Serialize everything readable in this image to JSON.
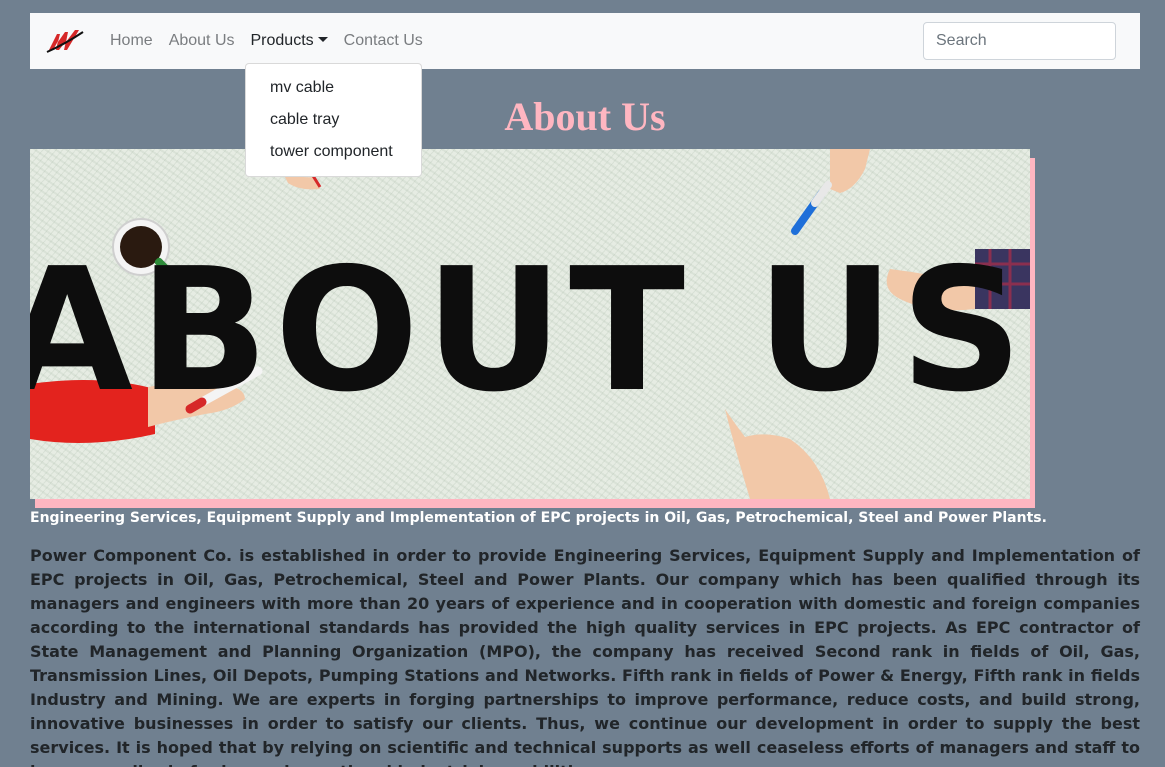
{
  "nav": {
    "logo_icon": "power-component-logo",
    "items": [
      {
        "label": "Home"
      },
      {
        "label": "About Us"
      },
      {
        "label": "Products"
      },
      {
        "label": "Contact Us"
      }
    ],
    "search_placeholder": "Search"
  },
  "dropdown": {
    "items": [
      {
        "label": "mv cable"
      },
      {
        "label": "cable tray"
      },
      {
        "label": "tower component"
      }
    ]
  },
  "page": {
    "title": "About Us",
    "banner": {
      "image_text": "ABOUT US"
    },
    "subtitle": "Engineering Services, Equipment Supply and Implementation of EPC projects in Oil, Gas, Petrochemical, Steel and Power Plants.",
    "body": "Power Component Co. is established in order to provide Engineering Services, Equipment Supply and Implementation of EPC projects in Oil, Gas, Petrochemical, Steel and Power Plants. Our company which has been qualified through its managers and engineers with more than 20 years of experience and in cooperation with domestic and foreign companies according to the international standards has provided the high quality services in EPC projects. As EPC contractor of State Management and Planning Organization (MPO), the company has received Second rank in fields of Oil, Gas, Transmission Lines, Oil Depots, Pumping Stations and Networks. Fifth rank in fields of Power & Energy, Fifth rank in fields Industry and Mining. We are experts in forging partnerships to improve performance, reduce costs, and build strong, innovative businesses in order to satisfy our clients. Thus, we continue our development in order to supply the best services. It is hoped that by relying on scientific and technical supports as well ceaseless efforts of managers and staff to have a small role for improving national industrial capabilities."
  },
  "colors": {
    "background": "#708090",
    "title_accent": "#ffb6c1",
    "navbar": "#f8f9fa"
  }
}
